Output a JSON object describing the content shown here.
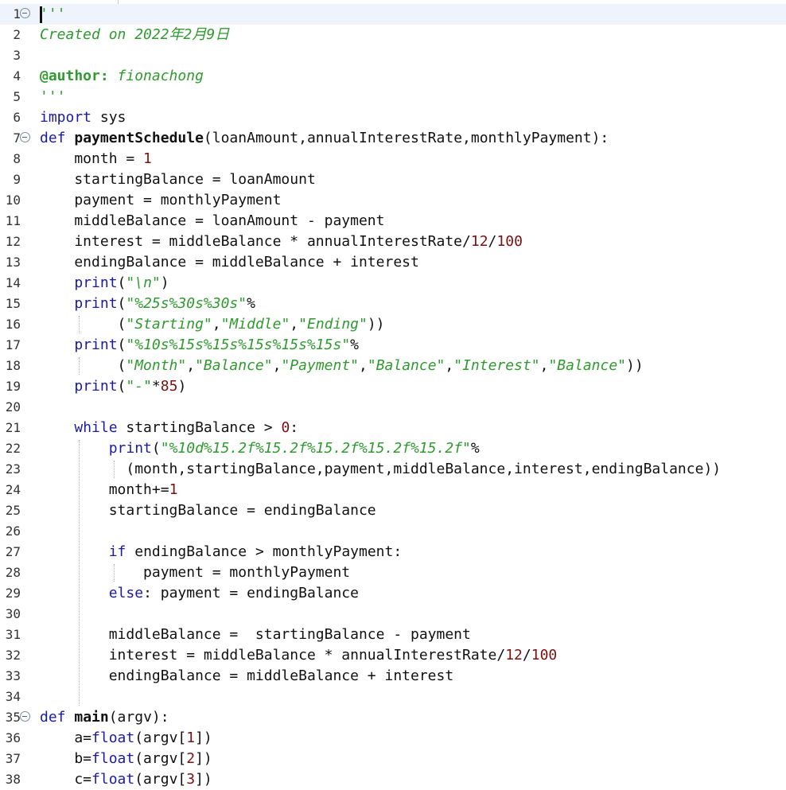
{
  "editor": {
    "lines": [
      {
        "n": "1",
        "tokens": [
          {
            "t": "'''",
            "c": "str"
          }
        ]
      },
      {
        "n": "2",
        "tokens": [
          {
            "t": "Created on 2022年2月9日",
            "c": "comment"
          }
        ]
      },
      {
        "n": "3",
        "tokens": []
      },
      {
        "n": "4",
        "tokens": [
          {
            "t": "@author:",
            "c": "deco"
          },
          {
            "t": " fionachong",
            "c": "comment"
          }
        ]
      },
      {
        "n": "5",
        "tokens": [
          {
            "t": "'''",
            "c": "str"
          }
        ]
      },
      {
        "n": "6",
        "tokens": [
          {
            "t": "import",
            "c": "kw"
          },
          {
            "t": " sys",
            "c": ""
          }
        ]
      },
      {
        "n": "7",
        "tokens": [
          {
            "t": "def",
            "c": "kw"
          },
          {
            "t": " ",
            "c": ""
          },
          {
            "t": "paymentSchedule",
            "c": "fn"
          },
          {
            "t": "(loanAmount,annualInterestRate,monthlyPayment):",
            "c": ""
          }
        ]
      },
      {
        "n": "8",
        "tokens": [
          {
            "t": "    month = ",
            "c": ""
          },
          {
            "t": "1",
            "c": "num"
          }
        ]
      },
      {
        "n": "9",
        "tokens": [
          {
            "t": "    startingBalance = loanAmount",
            "c": ""
          }
        ]
      },
      {
        "n": "10",
        "tokens": [
          {
            "t": "    payment = monthlyPayment",
            "c": ""
          }
        ]
      },
      {
        "n": "11",
        "tokens": [
          {
            "t": "    middleBalance = loanAmount - payment",
            "c": ""
          }
        ]
      },
      {
        "n": "12",
        "tokens": [
          {
            "t": "    interest = middleBalance * annualInterestRate/",
            "c": ""
          },
          {
            "t": "12",
            "c": "num"
          },
          {
            "t": "/",
            "c": ""
          },
          {
            "t": "100",
            "c": "num"
          }
        ]
      },
      {
        "n": "13",
        "tokens": [
          {
            "t": "    endingBalance = middleBalance + interest",
            "c": ""
          }
        ]
      },
      {
        "n": "14",
        "tokens": [
          {
            "t": "    ",
            "c": ""
          },
          {
            "t": "print",
            "c": "builtin"
          },
          {
            "t": "(",
            "c": ""
          },
          {
            "t": "\"\\n\"",
            "c": "str"
          },
          {
            "t": ")",
            "c": ""
          }
        ]
      },
      {
        "n": "15",
        "tokens": [
          {
            "t": "    ",
            "c": ""
          },
          {
            "t": "print",
            "c": "builtin"
          },
          {
            "t": "(",
            "c": ""
          },
          {
            "t": "\"%25s%30s%30s\"",
            "c": "str"
          },
          {
            "t": "%",
            "c": ""
          }
        ]
      },
      {
        "n": "16",
        "tokens": [
          {
            "t": "         (",
            "c": ""
          },
          {
            "t": "\"Starting\"",
            "c": "str"
          },
          {
            "t": ",",
            "c": ""
          },
          {
            "t": "\"Middle\"",
            "c": "str"
          },
          {
            "t": ",",
            "c": ""
          },
          {
            "t": "\"Ending\"",
            "c": "str"
          },
          {
            "t": "))",
            "c": ""
          }
        ]
      },
      {
        "n": "17",
        "tokens": [
          {
            "t": "    ",
            "c": ""
          },
          {
            "t": "print",
            "c": "builtin"
          },
          {
            "t": "(",
            "c": ""
          },
          {
            "t": "\"%10s%15s%15s%15s%15s%15s\"",
            "c": "str"
          },
          {
            "t": "%",
            "c": ""
          }
        ]
      },
      {
        "n": "18",
        "tokens": [
          {
            "t": "         (",
            "c": ""
          },
          {
            "t": "\"Month\"",
            "c": "str"
          },
          {
            "t": ",",
            "c": ""
          },
          {
            "t": "\"Balance\"",
            "c": "str"
          },
          {
            "t": ",",
            "c": ""
          },
          {
            "t": "\"Payment\"",
            "c": "str"
          },
          {
            "t": ",",
            "c": ""
          },
          {
            "t": "\"Balance\"",
            "c": "str"
          },
          {
            "t": ",",
            "c": ""
          },
          {
            "t": "\"Interest\"",
            "c": "str"
          },
          {
            "t": ",",
            "c": ""
          },
          {
            "t": "\"Balance\"",
            "c": "str"
          },
          {
            "t": "))",
            "c": ""
          }
        ]
      },
      {
        "n": "19",
        "tokens": [
          {
            "t": "    ",
            "c": ""
          },
          {
            "t": "print",
            "c": "builtin"
          },
          {
            "t": "(",
            "c": ""
          },
          {
            "t": "\"-\"",
            "c": "str"
          },
          {
            "t": "*",
            "c": ""
          },
          {
            "t": "85",
            "c": "num"
          },
          {
            "t": ")",
            "c": ""
          }
        ]
      },
      {
        "n": "20",
        "tokens": []
      },
      {
        "n": "21",
        "tokens": [
          {
            "t": "    ",
            "c": ""
          },
          {
            "t": "while",
            "c": "kw"
          },
          {
            "t": " startingBalance > ",
            "c": ""
          },
          {
            "t": "0",
            "c": "num"
          },
          {
            "t": ":",
            "c": ""
          }
        ]
      },
      {
        "n": "22",
        "tokens": [
          {
            "t": "        ",
            "c": ""
          },
          {
            "t": "print",
            "c": "builtin"
          },
          {
            "t": "(",
            "c": ""
          },
          {
            "t": "\"%10d%15.2f%15.2f%15.2f%15.2f%15.2f\"",
            "c": "str"
          },
          {
            "t": "%",
            "c": ""
          }
        ]
      },
      {
        "n": "23",
        "tokens": [
          {
            "t": "          (month,startingBalance,payment,middleBalance,interest,endingBalance))",
            "c": ""
          }
        ]
      },
      {
        "n": "24",
        "tokens": [
          {
            "t": "        month+=",
            "c": ""
          },
          {
            "t": "1",
            "c": "num"
          }
        ]
      },
      {
        "n": "25",
        "tokens": [
          {
            "t": "        startingBalance = endingBalance",
            "c": ""
          }
        ]
      },
      {
        "n": "26",
        "tokens": []
      },
      {
        "n": "27",
        "tokens": [
          {
            "t": "        ",
            "c": ""
          },
          {
            "t": "if",
            "c": "kw"
          },
          {
            "t": " endingBalance > monthlyPayment:",
            "c": ""
          }
        ]
      },
      {
        "n": "28",
        "tokens": [
          {
            "t": "            payment = monthlyPayment",
            "c": ""
          }
        ]
      },
      {
        "n": "29",
        "tokens": [
          {
            "t": "        ",
            "c": ""
          },
          {
            "t": "else",
            "c": "kw"
          },
          {
            "t": ": payment = endingBalance",
            "c": ""
          }
        ]
      },
      {
        "n": "30",
        "tokens": []
      },
      {
        "n": "31",
        "tokens": [
          {
            "t": "        middleBalance =  startingBalance - payment",
            "c": ""
          }
        ]
      },
      {
        "n": "32",
        "tokens": [
          {
            "t": "        interest = middleBalance * annualInterestRate/",
            "c": ""
          },
          {
            "t": "12",
            "c": "num"
          },
          {
            "t": "/",
            "c": ""
          },
          {
            "t": "100",
            "c": "num"
          }
        ]
      },
      {
        "n": "33",
        "tokens": [
          {
            "t": "        endingBalance = middleBalance + interest",
            "c": ""
          }
        ]
      },
      {
        "n": "34",
        "tokens": []
      },
      {
        "n": "35",
        "tokens": [
          {
            "t": "def",
            "c": "kw"
          },
          {
            "t": " ",
            "c": ""
          },
          {
            "t": "main",
            "c": "fn"
          },
          {
            "t": "(argv):",
            "c": ""
          }
        ]
      },
      {
        "n": "36",
        "tokens": [
          {
            "t": "    a=",
            "c": ""
          },
          {
            "t": "float",
            "c": "builtin"
          },
          {
            "t": "(argv[",
            "c": ""
          },
          {
            "t": "1",
            "c": "num"
          },
          {
            "t": "])",
            "c": ""
          }
        ]
      },
      {
        "n": "37",
        "tokens": [
          {
            "t": "    b=",
            "c": ""
          },
          {
            "t": "float",
            "c": "builtin"
          },
          {
            "t": "(argv[",
            "c": ""
          },
          {
            "t": "2",
            "c": "num"
          },
          {
            "t": "])",
            "c": ""
          }
        ]
      },
      {
        "n": "38",
        "tokens": [
          {
            "t": "    c=",
            "c": ""
          },
          {
            "t": "float",
            "c": "builtin"
          },
          {
            "t": "(argv[",
            "c": ""
          },
          {
            "t": "3",
            "c": "num"
          },
          {
            "t": "])",
            "c": ""
          }
        ]
      }
    ],
    "fold_lines": [
      "1",
      "7",
      "35"
    ],
    "current_line": "1"
  }
}
